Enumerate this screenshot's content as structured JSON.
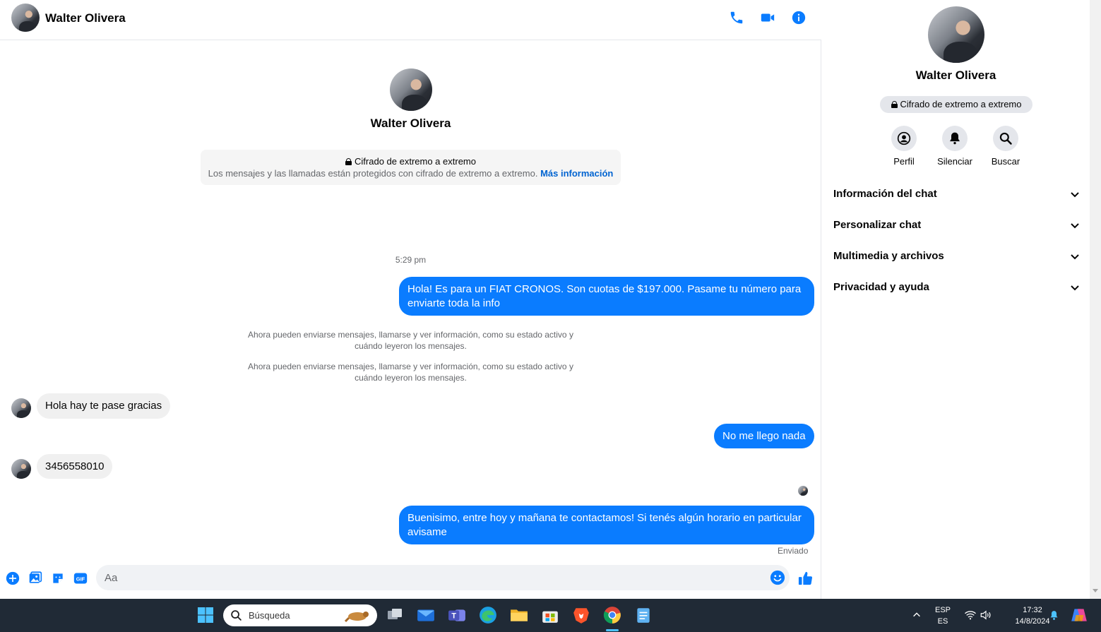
{
  "header": {
    "name": "Walter Olivera"
  },
  "intro": {
    "name": "Walter Olivera",
    "e2ee_title": "Cifrado de extremo a extremo",
    "e2ee_text": "Los mensajes y las llamadas están protegidos con cifrado de extremo a extremo.",
    "e2ee_link": "Más información"
  },
  "conversation": {
    "timestamp": "5:29 pm",
    "msg1": "Hola! Es para un FIAT CRONOS. Son cuotas de $197.000. Pasame tu número para enviarte toda la info",
    "system1": "Ahora pueden enviarse mensajes, llamarse y ver información, como su estado activo y cuándo leyeron los mensajes.",
    "system2": "Ahora pueden enviarse mensajes, llamarse y ver información, como su estado activo y cuándo leyeron los mensajes.",
    "msg2": "Hola hay te pase gracias",
    "msg3": "No me llego nada",
    "msg4": "3456558010",
    "msg5": "Buenisimo, entre hoy y mañana te contactamos! Si tenés algún horario en particular avisame",
    "status": "Enviado"
  },
  "composer": {
    "placeholder": "Aa"
  },
  "sidebar": {
    "name": "Walter Olivera",
    "badge": "Cifrado de extremo a extremo",
    "actions": {
      "profile": "Perfil",
      "mute": "Silenciar",
      "search": "Buscar"
    },
    "sections": [
      "Información del chat",
      "Personalizar chat",
      "Multimedia y archivos",
      "Privacidad y ayuda"
    ]
  },
  "taskbar": {
    "search_placeholder": "Búsqueda",
    "lang1": "ESP",
    "lang2": "ES",
    "time": "17:32",
    "date": "14/8/2024"
  },
  "colors": {
    "accent": "#0a7cff",
    "taskbar": "#202a36"
  }
}
